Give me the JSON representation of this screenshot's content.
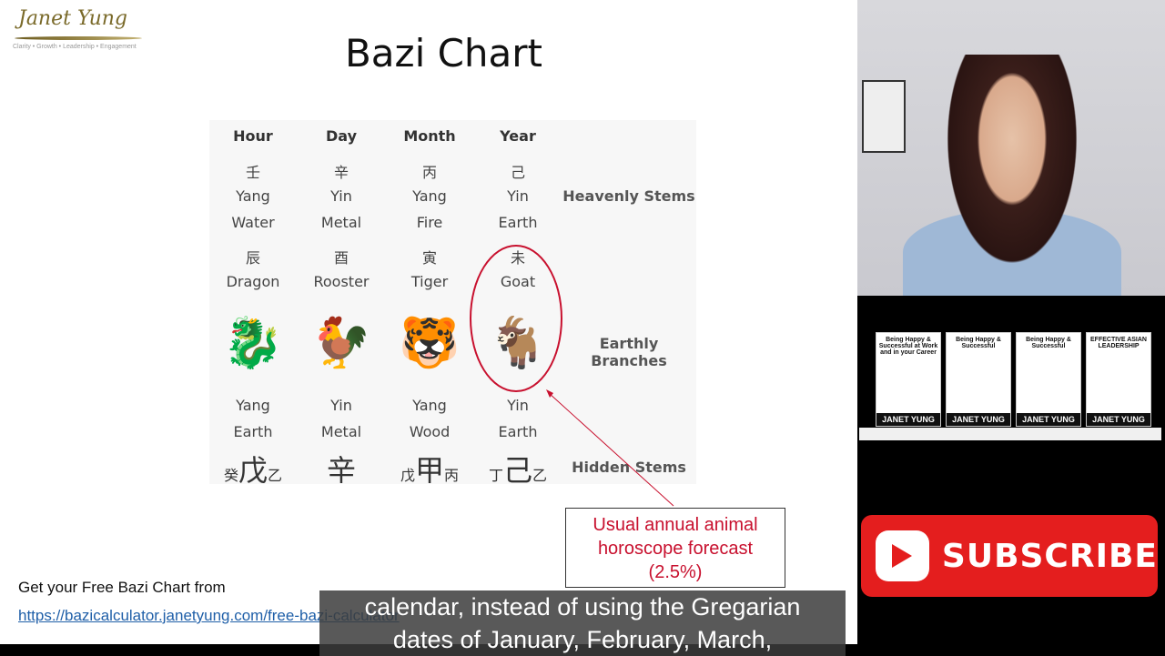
{
  "logo": {
    "name": "Janet Yung",
    "tagline": "Clarity • Growth • Leadership • Engagement"
  },
  "title": "Bazi Chart",
  "columns": [
    {
      "header": "Hour",
      "stem_char": "壬",
      "stem_polarity": "Yang",
      "stem_element": "Water",
      "branch_char": "辰",
      "animal": "Dragon",
      "animal_icon": "🐉",
      "branch_polarity": "Yang",
      "branch_element": "Earth",
      "hidden": [
        "癸",
        "戊",
        "乙"
      ]
    },
    {
      "header": "Day",
      "stem_char": "辛",
      "stem_polarity": "Yin",
      "stem_element": "Metal",
      "branch_char": "酉",
      "animal": "Rooster",
      "animal_icon": "🐓",
      "branch_polarity": "Yin",
      "branch_element": "Metal",
      "hidden": [
        "",
        "辛",
        ""
      ]
    },
    {
      "header": "Month",
      "stem_char": "丙",
      "stem_polarity": "Yang",
      "stem_element": "Fire",
      "branch_char": "寅",
      "animal": "Tiger",
      "animal_icon": "🐯",
      "branch_polarity": "Yang",
      "branch_element": "Wood",
      "hidden": [
        "戊",
        "甲",
        "丙"
      ]
    },
    {
      "header": "Year",
      "stem_char": "己",
      "stem_polarity": "Yin",
      "stem_element": "Earth",
      "branch_char": "未",
      "animal": "Goat",
      "animal_icon": "🐐",
      "branch_polarity": "Yin",
      "branch_element": "Earth",
      "hidden": [
        "丁",
        "己",
        "乙"
      ]
    }
  ],
  "row_labels": {
    "heavenly": "Heavenly Stems",
    "earthly": "Earthly Branches",
    "hidden": "Hidden Stems"
  },
  "callout": {
    "line1": "Usual annual animal",
    "line2": "horoscope forecast",
    "line3": "(2.5%)"
  },
  "footer": {
    "text": "Get your Free Bazi Chart from",
    "link": "https://bazicalculator.janetyung.com/free-bazi-calculator"
  },
  "caption": {
    "line1": "calendar, instead of using the Gregarian",
    "line2": "dates of January, February, March,"
  },
  "books": [
    {
      "title": "Being Happy & Successful at Work and in your Career",
      "author": "JANET YUNG"
    },
    {
      "title": "Being Happy & Successful",
      "author": "JANET YUNG"
    },
    {
      "title": "Being Happy & Successful",
      "author": "JANET YUNG"
    },
    {
      "title": "EFFECTIVE ASIAN LEADERSHIP",
      "author": "JANET YUNG"
    }
  ],
  "subscribe": {
    "label": "SUBSCRIBE"
  },
  "colors": {
    "accent": "#c8102e",
    "youtube": "#e41e1e",
    "link": "#1f5fa8"
  }
}
